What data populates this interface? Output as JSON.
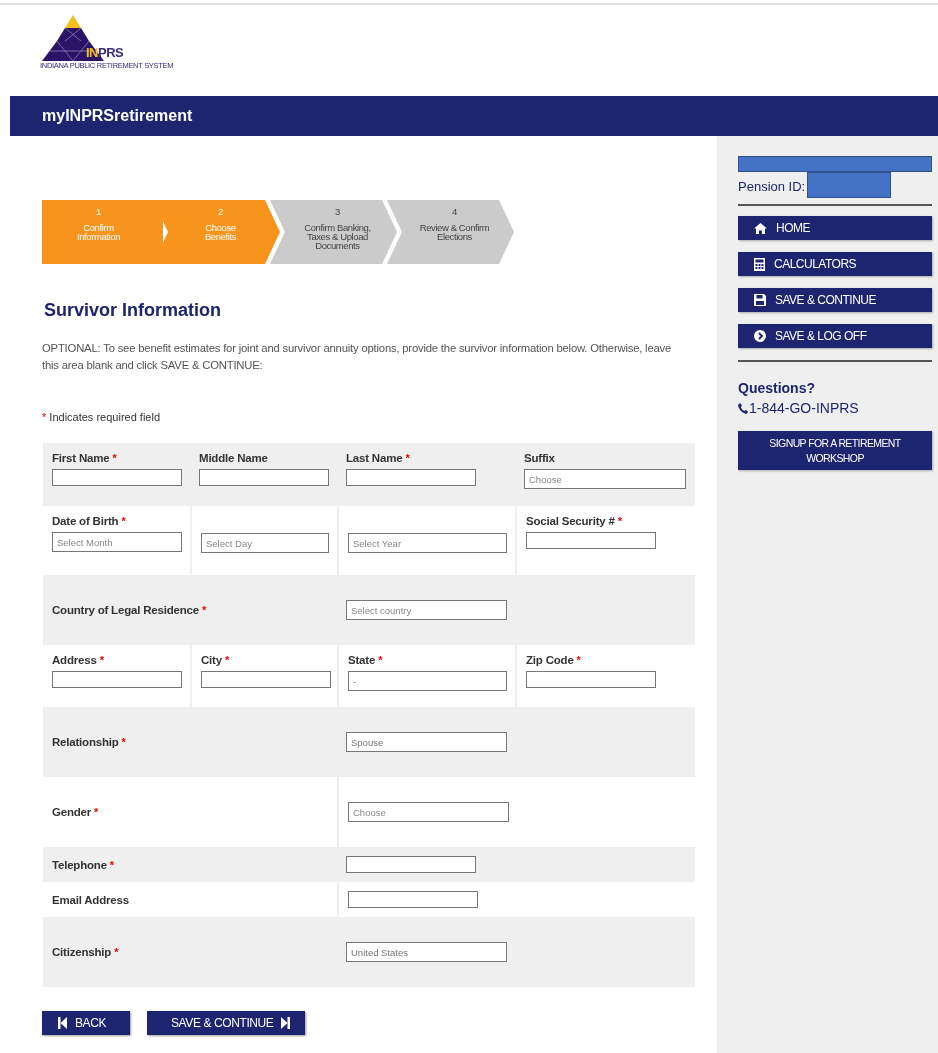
{
  "logo": {
    "highlight": "IN",
    "rest": "PRS",
    "tagline": "INDIANA PUBLIC RETIREMENT SYSTEM"
  },
  "header": {
    "title": "myINPRSretirement"
  },
  "steps": [
    {
      "number": "1",
      "lines": [
        "Confirm",
        "Information"
      ],
      "completed": true
    },
    {
      "number": "2",
      "lines": [
        "Choose",
        "Benefits"
      ],
      "completed": true
    },
    {
      "number": "3",
      "lines": [
        "Confirm Banking,",
        "Taxes & Upload",
        "Documents"
      ],
      "completed": false
    },
    {
      "number": "4",
      "lines": [
        "Review & Confirm",
        "Elections"
      ],
      "completed": false
    }
  ],
  "section": {
    "title": "Survivor Information",
    "intro": "OPTIONAL: To see benefit estimates for joint and survivor annuity options, provide the survivor information below. Otherwise, leave this area blank and click SAVE & CONTINUE:",
    "required_note": "Indicates required field",
    "required_mark": "*"
  },
  "form_rows": [
    {
      "kind": "quad",
      "cells": [
        {
          "label": "First Name",
          "required": true,
          "field": {
            "kind": "text"
          }
        },
        {
          "label": "Middle Name",
          "required": false,
          "field": {
            "kind": "text"
          }
        },
        {
          "label": "Last Name",
          "required": true,
          "field": {
            "kind": "text"
          }
        },
        {
          "label": "Suffix",
          "required": false,
          "field": {
            "kind": "select",
            "placeholder": "Choose"
          }
        }
      ]
    },
    {
      "kind": "quad",
      "cells": [
        {
          "label": "Date of Birth",
          "required": true,
          "field": {
            "kind": "select",
            "placeholder": "Select Month"
          }
        },
        {
          "field": {
            "kind": "select",
            "placeholder": "Select Day"
          }
        },
        {
          "field": {
            "kind": "select",
            "placeholder": "Select Year"
          }
        },
        {
          "label": "Social Security #",
          "required": true,
          "field": {
            "kind": "text"
          }
        }
      ]
    },
    {
      "kind": "span",
      "label": "Country of Legal Residence",
      "required": true,
      "field": {
        "kind": "select",
        "placeholder": "Select country"
      }
    },
    {
      "kind": "quad",
      "cells": [
        {
          "label": "Address",
          "required": true,
          "field": {
            "kind": "text"
          }
        },
        {
          "label": "City",
          "required": true,
          "field": {
            "kind": "text"
          }
        },
        {
          "label": "State",
          "required": true,
          "field": {
            "kind": "select",
            "value": "-"
          }
        },
        {
          "label": "Zip Code",
          "required": true,
          "field": {
            "kind": "text"
          }
        }
      ]
    },
    {
      "kind": "span",
      "label": "Relationship",
      "required": true,
      "field": {
        "kind": "select",
        "value": "Spouse"
      }
    },
    {
      "kind": "span",
      "label": "Gender",
      "required": true,
      "field": {
        "kind": "select",
        "placeholder": "Choose"
      }
    },
    {
      "kind": "span",
      "label": "Telephone",
      "required": true,
      "field": {
        "kind": "text"
      }
    },
    {
      "kind": "span",
      "label": "Email Address",
      "required": false,
      "field": {
        "kind": "text"
      }
    },
    {
      "kind": "span",
      "label": "Citizenship",
      "required": true,
      "field": {
        "kind": "select",
        "value": "United States"
      }
    }
  ],
  "actions": [
    {
      "kind": "back",
      "label": "BACK"
    },
    {
      "kind": "next",
      "label": "SAVE & CONTINUE"
    }
  ],
  "sidebar": {
    "pension_label": "Pension ID:",
    "menu": [
      {
        "kind": "home",
        "label": "HOME"
      },
      {
        "kind": "calculator",
        "label": "CALCULATORS"
      },
      {
        "kind": "save",
        "label": "SAVE & CONTINUE"
      },
      {
        "kind": "logoff",
        "label": "SAVE & LOG OFF"
      }
    ],
    "questions": "Questions?",
    "phone": "1-844-GO-INPRS",
    "workshop_button": "SIGNUP FOR A RETIREMENT WORKSHOP"
  }
}
